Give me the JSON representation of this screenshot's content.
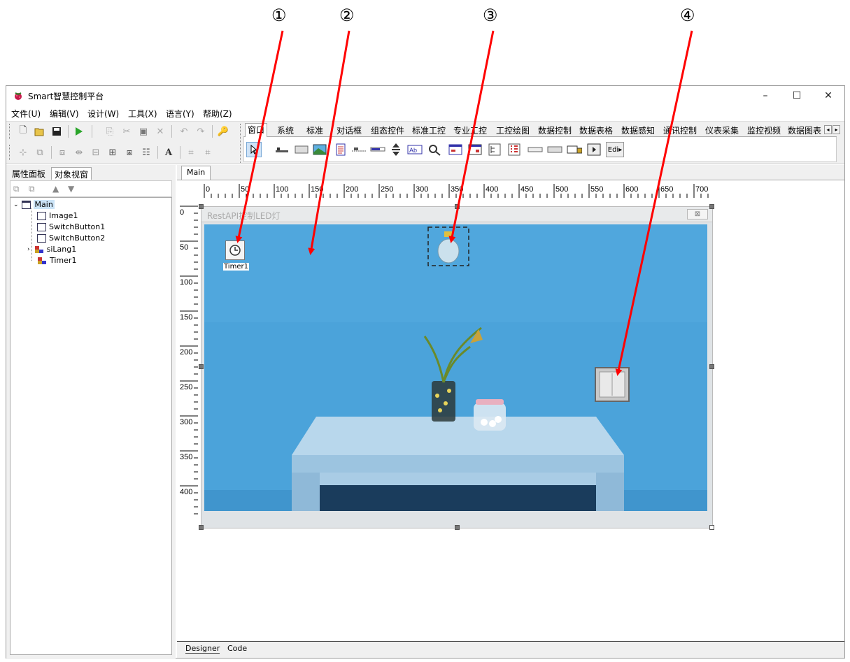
{
  "annotations": [
    "①",
    "②",
    "③",
    "④"
  ],
  "window": {
    "title": "Smart智慧控制平台",
    "minimize": "–",
    "maximize": "☐",
    "close": "✕"
  },
  "menu": [
    "文件(U)",
    "编辑(V)",
    "设计(W)",
    "工具(X)",
    "语言(Y)",
    "帮助(Z)"
  ],
  "palette_tabs": [
    "窗口",
    "系统",
    "标准",
    "对话框",
    "组态控件",
    "标准工控",
    "专业工控",
    "工控绘图",
    "数据控制",
    "数据表格",
    "数据感知",
    "通讯控制",
    "仪表采集",
    "监控视频",
    "数据图表"
  ],
  "left_tabs": [
    "属性面板",
    "对象视窗"
  ],
  "tree": [
    "Main",
    "Image1",
    "SwitchButton1",
    "SwitchButton2",
    "siLang1",
    "Timer1"
  ],
  "doc_tab": "Main",
  "ruler_h": [
    "0",
    "50",
    "100",
    "150",
    "200",
    "250",
    "300",
    "350",
    "400",
    "450",
    "500",
    "550",
    "600",
    "650",
    "700"
  ],
  "ruler_v": [
    "0",
    "50",
    "100",
    "150",
    "200",
    "250",
    "300",
    "350",
    "400"
  ],
  "form": {
    "title": "RestAPI控制LED灯",
    "close_glyph": "⊠"
  },
  "timer_label": "Timer1",
  "edit_glyph": "Edi",
  "bottom_tabs": [
    "Designer",
    "Code"
  ],
  "colors": {
    "arrow": "#ff0000",
    "wall": "#4aa0d8",
    "selection": "#3399ff"
  }
}
